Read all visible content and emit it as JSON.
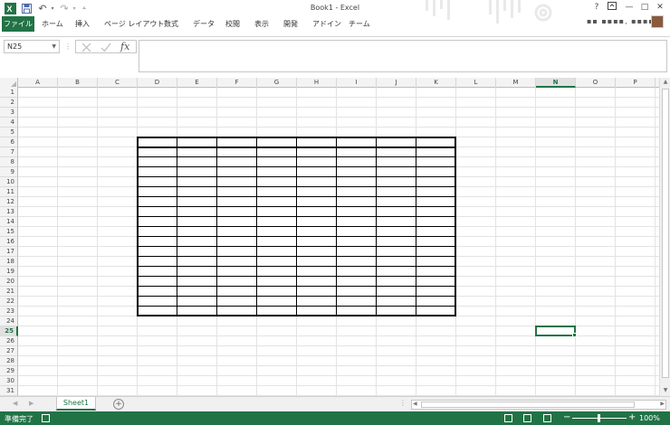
{
  "window": {
    "title": "Book1 - Excel"
  },
  "title_bar_icons": [
    "excel-logo-icon",
    "save-icon",
    "undo-icon",
    "redo-icon",
    "customize-qat-icon"
  ],
  "window_controls": {
    "help": "?",
    "minimize": "—",
    "restore": "□",
    "close": "✕"
  },
  "user": {
    "name": "▪▪ ▪▪▪▪, ▪▪▪▪▪"
  },
  "ribbon": {
    "file_tab": "ファイル",
    "tabs": [
      "ホーム",
      "挿入",
      "ページ レイアウト",
      "数式",
      "データ",
      "校閲",
      "表示",
      "開発",
      "アドイン",
      "チーム"
    ]
  },
  "formula_bar": {
    "name_box": "N25",
    "fx_label": "fx",
    "value": ""
  },
  "grid": {
    "columns": [
      "A",
      "B",
      "C",
      "D",
      "E",
      "F",
      "G",
      "H",
      "I",
      "J",
      "K",
      "L",
      "M",
      "N",
      "O",
      "P"
    ],
    "rows": [
      "1",
      "2",
      "3",
      "4",
      "5",
      "6",
      "7",
      "8",
      "9",
      "10",
      "11",
      "12",
      "13",
      "14",
      "15",
      "16",
      "17",
      "18",
      "19",
      "20",
      "21",
      "22",
      "23",
      "24",
      "25",
      "26",
      "27",
      "28",
      "29",
      "30",
      "31"
    ],
    "active_cell": "N25",
    "bordered_table_range": "D6:K23"
  },
  "sheets": {
    "tabs": [
      "Sheet1"
    ]
  },
  "status_bar": {
    "status": "準備完了",
    "zoom": "100%"
  },
  "colors": {
    "accent": "#217346"
  }
}
